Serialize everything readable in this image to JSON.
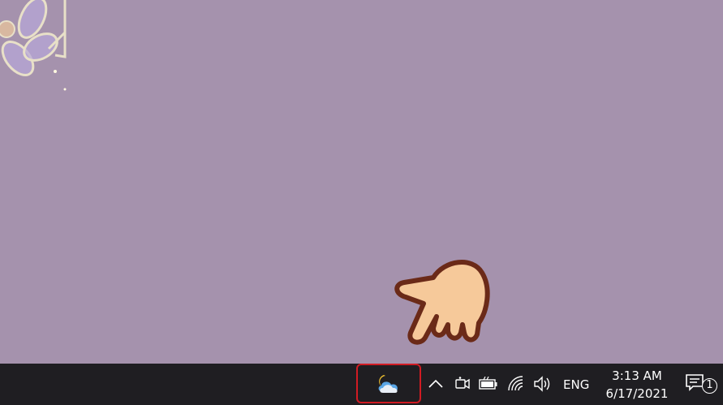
{
  "desktop": {
    "background_color": "#a592ad",
    "wallpaper_decoration": "flower-icon",
    "pointer": "pointing-hand-icon"
  },
  "taskbar": {
    "background_color": "#1f1e22",
    "weather_widget": {
      "icon": "partly-cloudy-night-icon",
      "highlight_color": "#d11b23"
    },
    "tray": {
      "icons": [
        "chevron-up-icon",
        "camera-icon",
        "battery-icon",
        "wifi-icon",
        "volume-icon"
      ],
      "language": "ENG"
    },
    "clock": {
      "time": "3:13 AM",
      "date": "6/17/2021"
    },
    "notifications": {
      "icon": "action-center-icon",
      "count": "1"
    }
  }
}
